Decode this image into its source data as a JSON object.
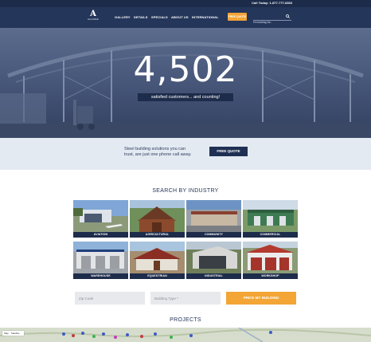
{
  "topbar": {
    "call_label": "Call Today: 1-877-777-8333"
  },
  "nav": {
    "logo_text": "A",
    "logo_sub": "ALLIANCE",
    "items": [
      "GALLERY",
      "DETAILS",
      "SPECIALS",
      "ABOUT US",
      "INTERNATIONAL"
    ],
    "quote_label": "FREE QUOTE",
    "search_placeholder": "I'm looking for..."
  },
  "hero": {
    "count": "4,502",
    "tagline": "satisfied customers... and counting!"
  },
  "band": {
    "line1": "Steel building solutions you can",
    "line2": "trust, are just one phone call away.",
    "button": "FREE QUOTE"
  },
  "industry": {
    "title": "SEARCH BY INDUSTRY",
    "tiles": [
      "AVIATION",
      "AGRICULTURAL",
      "COMMUNITY",
      "COMMERCIAL",
      "WAREHOUSE",
      "EQUESTRIAN",
      "INDUSTRIAL",
      "WORKSHOP"
    ]
  },
  "form": {
    "zip_placeholder": "Zip Code",
    "type_placeholder": "Building Type *",
    "price_button": "PRICE MY BUILDING"
  },
  "projects": {
    "title": "PROJECTS",
    "map_toggle": [
      "Map",
      "Satellite"
    ]
  },
  "colors": {
    "navy": "#24365a",
    "accent": "#f3a536",
    "band": "#e3eaf2"
  }
}
